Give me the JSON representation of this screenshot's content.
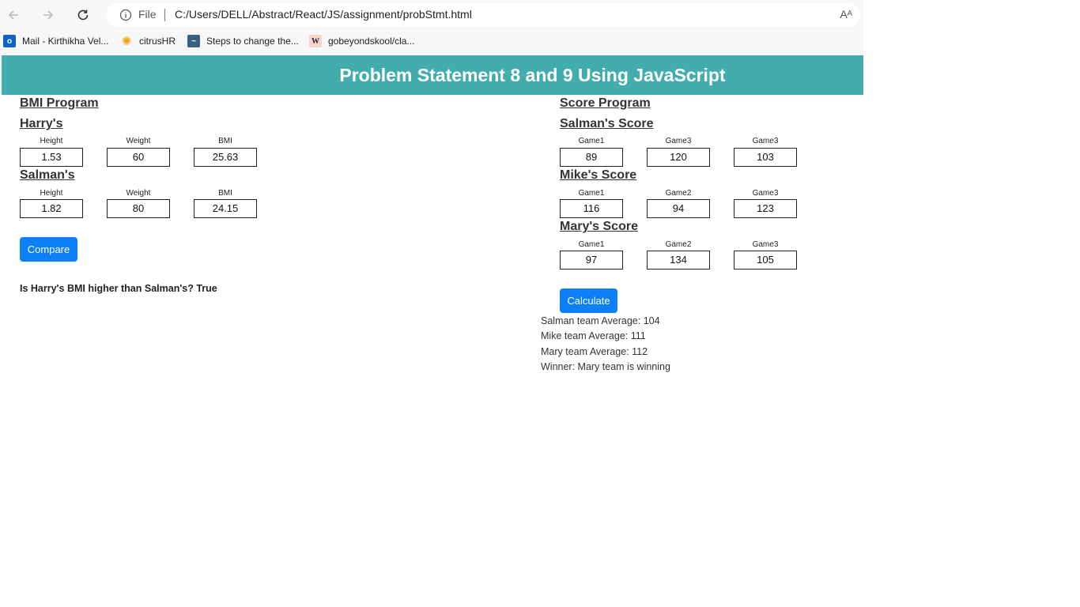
{
  "browser": {
    "address": {
      "file_label": "File",
      "url": "C:/Users/DELL/Abstract/React/JS/assignment/probStmt.html",
      "read_aloud": "Aᴬ"
    },
    "bookmarks": [
      {
        "label": "Mail - Kirthikha Vel...",
        "icon": "outlook-icon"
      },
      {
        "label": "citrusHR",
        "icon": "citrus-icon"
      },
      {
        "label": "Steps to change the...",
        "icon": "link-icon"
      },
      {
        "label": "gobeyondskool/cla...",
        "icon": "w-icon"
      }
    ]
  },
  "banner": {
    "title": "Problem Statement 8 and 9 Using JavaScript"
  },
  "bmi": {
    "heading": "BMI Program",
    "harry": {
      "heading": "Harry's",
      "labels": [
        "Height",
        "Weight",
        "BMI"
      ],
      "values": [
        "1.53",
        "60",
        "25.63"
      ]
    },
    "salman": {
      "heading": "Salman's",
      "labels": [
        "Height",
        "Weight",
        "BMI"
      ],
      "values": [
        "1.82",
        "80",
        "24.15"
      ]
    },
    "compare_label": "Compare",
    "result": "Is Harry's BMI higher than Salman's? True"
  },
  "score": {
    "heading": "Score Program",
    "salman": {
      "heading": "Salman's Score",
      "labels": [
        "Game1",
        "Game3",
        "Game3"
      ],
      "values": [
        "89",
        "120",
        "103"
      ]
    },
    "mike": {
      "heading": "Mike's Score",
      "labels": [
        "Game1",
        "Game2",
        "Game3"
      ],
      "values": [
        "116",
        "94",
        "123"
      ]
    },
    "mary": {
      "heading": "Mary's Score",
      "labels": [
        "Game1",
        "Game2",
        "Game3"
      ],
      "values": [
        "97",
        "134",
        "105"
      ]
    },
    "calculate_label": "Calculate",
    "results": [
      "Salman team Average: 104",
      "Mike team Average: 111",
      "Mary team Average: 112",
      "Winner: Mary team is winning"
    ]
  },
  "colors": {
    "banner": "#43adad",
    "button": "#0d7ff7"
  }
}
